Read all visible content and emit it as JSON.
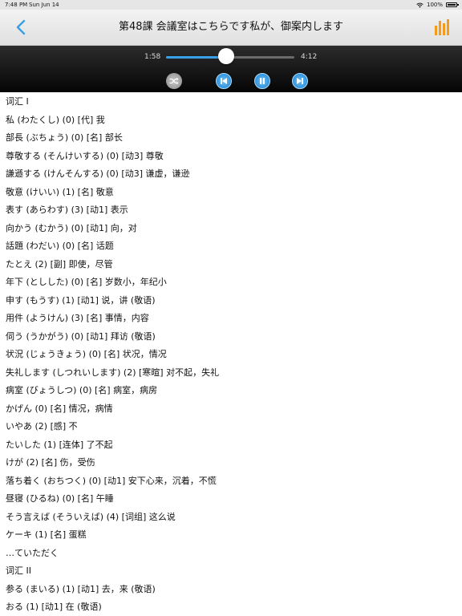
{
  "status_bar": {
    "time": "7:48 PM",
    "date": "Sun Jun 14",
    "battery": "100%",
    "battery_level": 1.0
  },
  "nav": {
    "title": "第48課 会議室はこちらです私が、御案内します",
    "back_icon": "chevron-left-icon",
    "chart_icon": "bar-chart-icon",
    "accent_color": "#38a0e6",
    "chart_color": "#f39b1c"
  },
  "player": {
    "current_time": "1:58",
    "total_time": "4:12",
    "progress": 0.468,
    "controls": [
      "shuffle-icon",
      "previous-track-icon",
      "pause-icon",
      "next-track-icon"
    ]
  },
  "content": {
    "lines": [
      "词汇 I",
      "私 (わたくし) (0) [代] 我",
      "部長 (ぶちょう) (0) [名] 部长",
      "尊敬する (そんけいする) (0) [动3] 尊敬",
      "謙遜する (けんそんする) (0) [动3] 谦虚，谦逊",
      "敬意 (けいい) (1) [名] 敬意",
      "表す (あらわす) (3) [动1] 表示",
      "向かう (むかう) (0) [动1] 向，对",
      "話題 (わだい) (0) [名] 话题",
      "たとえ (2) [副] 即使，尽管",
      "年下 (としした) (0) [名] 岁数小，年纪小",
      "申す (もうす) (1) [动1] 说，讲 (敬语)",
      "用件 (ようけん) (3) [名] 事情，内容",
      "伺う (うかがう) (0) [动1] 拜访 (敬语)",
      "状況 (じょうきょう) (0) [名] 状况，情况",
      "失礼します (しつれいします) (2) [寒暄] 对不起，失礼",
      "病室 (びょうしつ) (0) [名] 病室，病房",
      "かげん (0) [名] 情况，病情",
      "いやあ (2) [感] 不",
      "たいした (1) [连体] 了不起",
      "けが (2) [名] 伤，受伤",
      "落ち着く (おちつく) (0) [动1] 安下心来，沉着，不慌",
      "昼寝 (ひるね) (0) [名] 午睡",
      "そう言えば (そういえば) (4) [词组] 这么说",
      "ケーキ (1) [名] 蛋糕",
      "…ていただく",
      "词汇 II",
      "参る (まいる) (1) [动1] 去，来 (敬语)",
      "おる (1) [动1] 在 (敬语)"
    ]
  }
}
